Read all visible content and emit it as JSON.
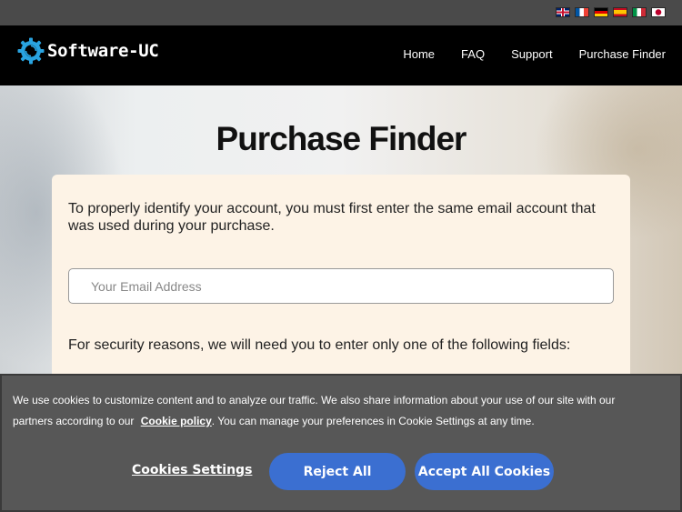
{
  "flags": [
    "en",
    "fr",
    "de",
    "es",
    "it",
    "jp"
  ],
  "brand": {
    "name": "Software-UC",
    "icon": "gear-logo-icon",
    "accent": "#29a3e0"
  },
  "nav": {
    "items": [
      "Home",
      "FAQ",
      "Support",
      "Purchase Finder"
    ]
  },
  "page": {
    "title": "Purchase Finder"
  },
  "form": {
    "intro": "To properly identify your account, you must first enter the same email account that was used during your purchase.",
    "email_placeholder": "Your Email Address",
    "email_value": "",
    "security_text": "For security reasons, we will need you to enter only one of the following fields:"
  },
  "cookie": {
    "text_before": "We use cookies to customize content and to analyze our traffic. We also share information about your use of our site with our partners according to our",
    "link_text": "Cookie policy",
    "text_after": ". You can manage your preferences in Cookie Settings at any time.",
    "settings_label": "Cookies Settings",
    "reject_label": "Reject All",
    "accept_label": "Accept All Cookies",
    "button_color": "#3b6fd1"
  }
}
